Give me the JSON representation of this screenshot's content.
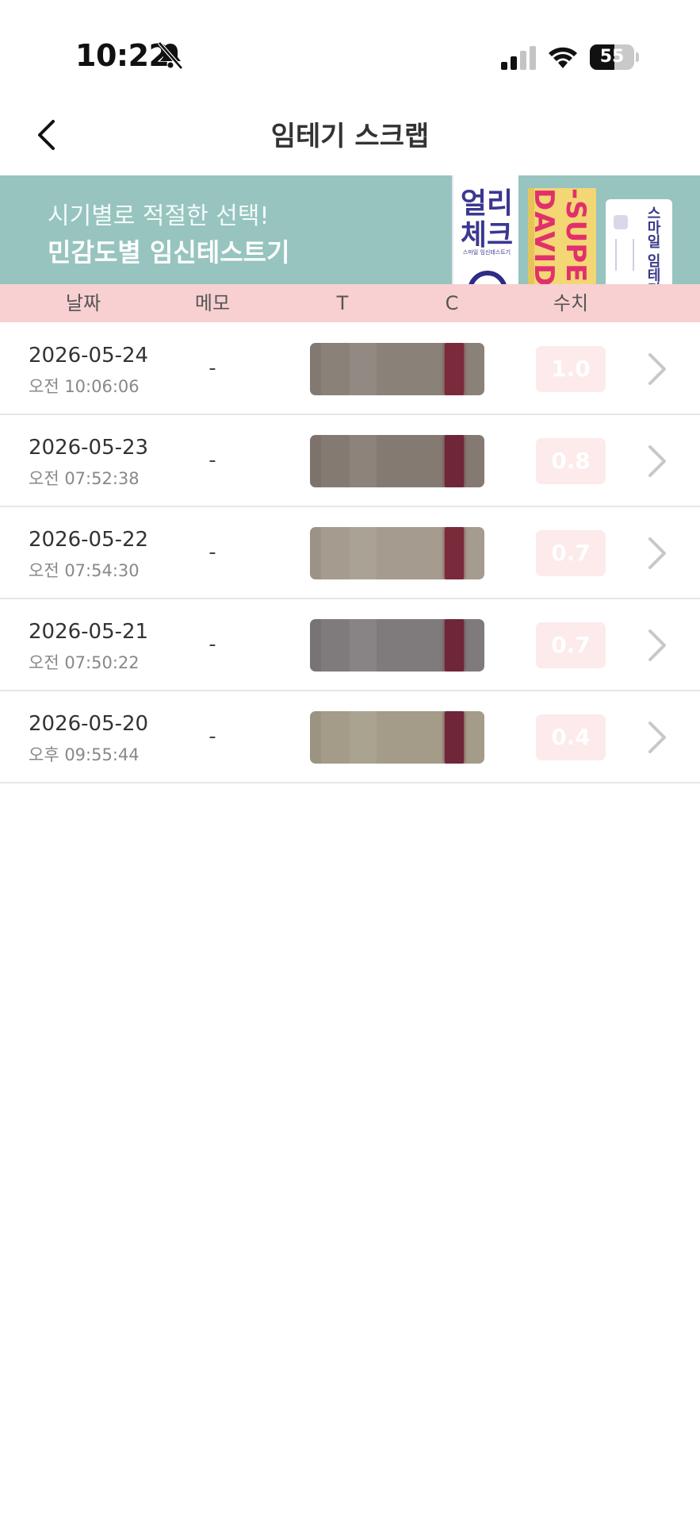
{
  "status_bar": {
    "time": "10:22",
    "battery": "55",
    "battery_level_pct": 55
  },
  "header": {
    "title": "임테기 스크랩"
  },
  "banner": {
    "line1": "시기별로 적절한 선택!",
    "line2": "민감도별 임신테스트기",
    "product1_line1": "얼리",
    "product1_line2": "체크",
    "product1_sub": "스마일 임신테스트기",
    "product2": "-SUPER DAVID",
    "product3": "스마일 임테기"
  },
  "table": {
    "columns": {
      "date": "날짜",
      "memo": "메모",
      "t": "T",
      "c": "C",
      "value": "수치"
    },
    "rows": [
      {
        "date": "2026-05-24",
        "time": "오전 10:06:06",
        "memo": "-",
        "value": "1.0",
        "strip_color": "#8a8179",
        "c_line_color": "#7a2a3a"
      },
      {
        "date": "2026-05-23",
        "time": "오전 07:52:38",
        "memo": "-",
        "value": "0.8",
        "strip_color": "#857a72",
        "c_line_color": "#6e2638"
      },
      {
        "date": "2026-05-22",
        "time": "오전 07:54:30",
        "memo": "-",
        "value": "0.7",
        "strip_color": "#a59b8e",
        "c_line_color": "#7a2a3a"
      },
      {
        "date": "2026-05-21",
        "time": "오전 07:50:22",
        "memo": "-",
        "value": "0.7",
        "strip_color": "#7f7b7c",
        "c_line_color": "#6e2638"
      },
      {
        "date": "2026-05-20",
        "time": "오후 09:55:44",
        "memo": "-",
        "value": "0.4",
        "strip_color": "#a49c88",
        "c_line_color": "#6e2638"
      }
    ]
  }
}
